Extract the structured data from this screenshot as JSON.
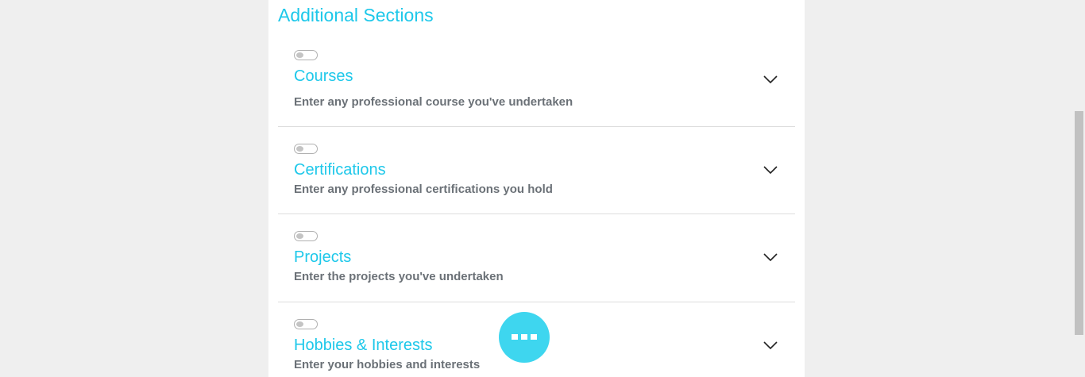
{
  "panel": {
    "title": "Additional Sections"
  },
  "sections": [
    {
      "title": "Courses",
      "description": "Enter any professional course you've undertaken",
      "toggle_on": false
    },
    {
      "title": "Certifications",
      "description": "Enter any professional certifications you hold",
      "toggle_on": false
    },
    {
      "title": "Projects",
      "description": "Enter the projects you've undertaken",
      "toggle_on": false
    },
    {
      "title": "Hobbies & Interests",
      "description": "Enter your hobbies and interests",
      "toggle_on": false
    }
  ],
  "fab": {
    "icon": "more-dots-icon"
  },
  "colors": {
    "accent": "#1ec8ea",
    "fab": "#3ed6ef",
    "description": "#6b7177",
    "background": "#efefef"
  }
}
